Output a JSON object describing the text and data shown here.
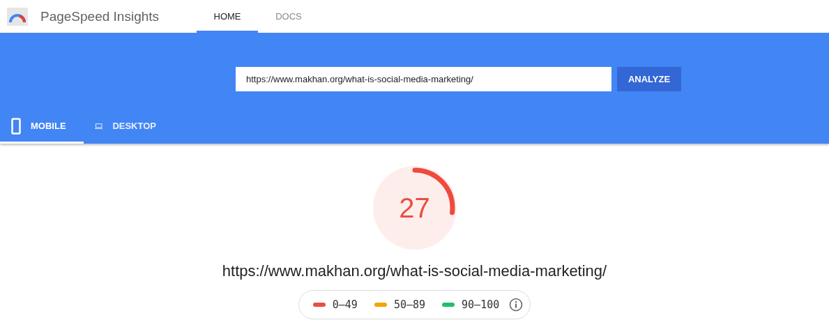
{
  "header": {
    "title": "PageSpeed Insights",
    "nav": [
      {
        "label": "HOME",
        "selected": true
      },
      {
        "label": "DOCS",
        "selected": false
      }
    ]
  },
  "search": {
    "value": "https://www.makhan.org/what-is-social-media-marketing/",
    "button": "ANALYZE"
  },
  "device_tabs": [
    {
      "label": "MOBILE",
      "kind": "mobile",
      "selected": true
    },
    {
      "label": "DESKTOP",
      "kind": "desktop",
      "selected": false
    }
  ],
  "score": {
    "value": "27",
    "level": 0.27
  },
  "url": "https://www.makhan.org/what-is-social-media-marketing/",
  "legend": [
    {
      "label": "0–49",
      "color": "#e8503f"
    },
    {
      "label": "50–89",
      "color": "#f4a300"
    },
    {
      "label": "90–100",
      "color": "#1fbf6a"
    }
  ]
}
